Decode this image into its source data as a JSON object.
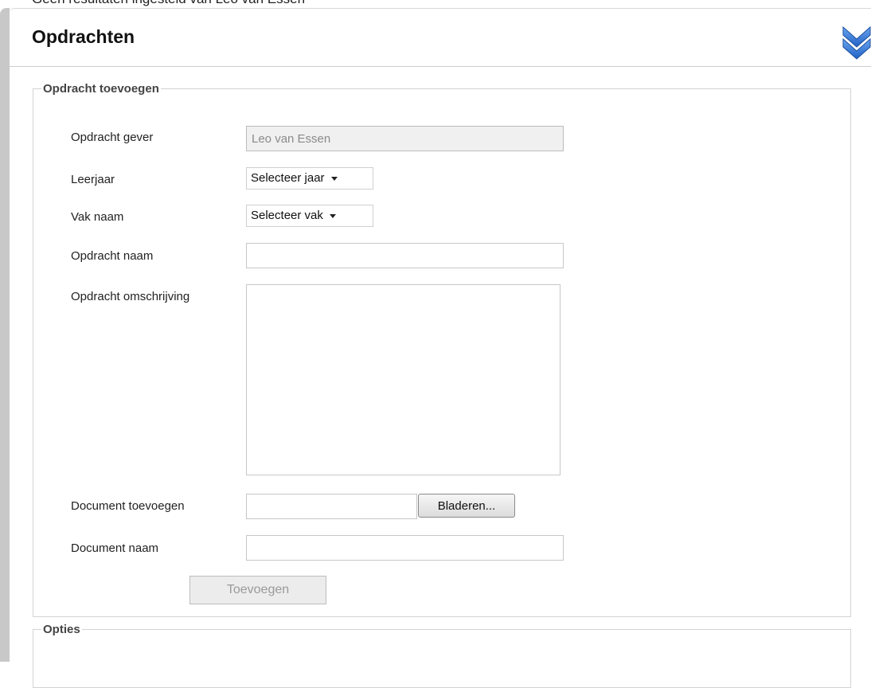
{
  "top_fragment": "Geen resultaten ingesteld van Leo van Essen",
  "page_title": "Opdrachten",
  "icons": {
    "collapse": "double-chevron-down-icon",
    "accent_color": "#3a78d6"
  },
  "add_section": {
    "legend": "Opdracht toevoegen",
    "opdracht_gever": {
      "label": "Opdracht gever",
      "value": "Leo van Essen"
    },
    "leerjaar": {
      "label": "Leerjaar",
      "selected": "Selecteer jaar"
    },
    "vak_naam": {
      "label": "Vak naam",
      "selected": "Selecteer vak"
    },
    "opdracht_naam": {
      "label": "Opdracht naam",
      "value": ""
    },
    "opdracht_omschrijving": {
      "label": "Opdracht omschrijving",
      "value": ""
    },
    "document_toevoegen": {
      "label": "Document toevoegen",
      "browse_label": "Bladeren..."
    },
    "document_naam": {
      "label": "Document naam",
      "value": ""
    },
    "submit_label": "Toevoegen"
  },
  "options_section": {
    "legend": "Opties"
  }
}
